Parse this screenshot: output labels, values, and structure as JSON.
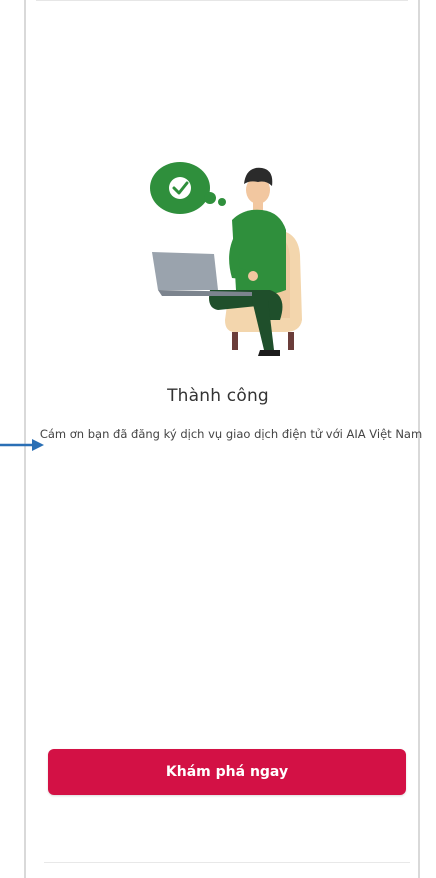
{
  "success": {
    "title": "Thành công",
    "message": "Cám ơn bạn đã đăng ký dịch vụ giao dịch điện tử với AIA Việt Nam",
    "illustration": "person-with-laptop-success-illustration"
  },
  "actions": {
    "explore_label": "Khám phá ngay"
  },
  "annotation": {
    "icon": "arrow-right-icon"
  },
  "colors": {
    "primary": "#d31145",
    "bubble": "#2f8f3c",
    "arrow": "#2a6fb5"
  }
}
